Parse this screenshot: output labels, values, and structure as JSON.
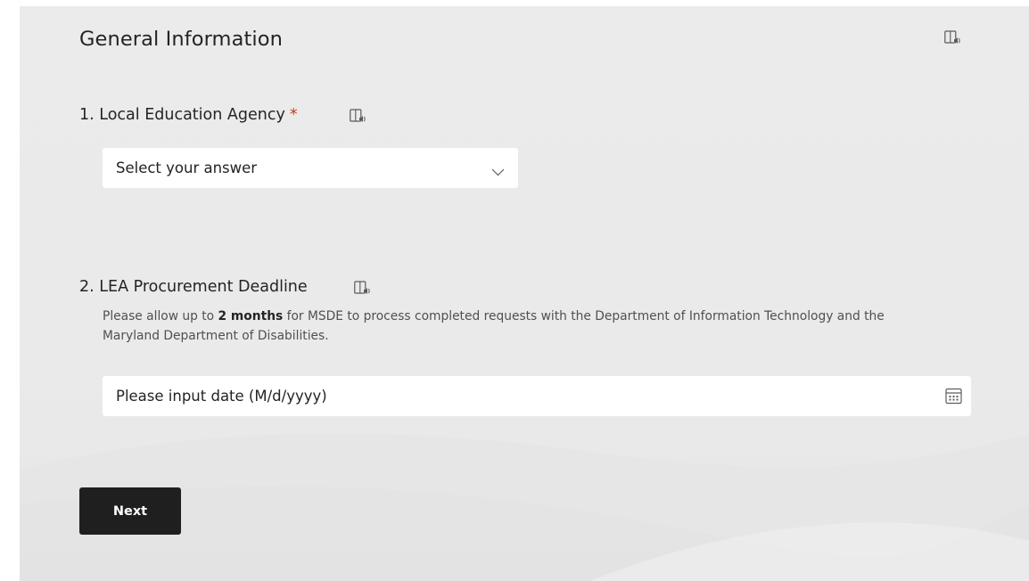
{
  "section": {
    "title": "General Information",
    "reader_icon": "immersive-reader-icon"
  },
  "questions": [
    {
      "number": "1.",
      "title": "Local Education Agency",
      "required_marker": "*",
      "input": {
        "type": "select",
        "value": "Select your answer",
        "icon": "chevron-down-icon"
      }
    },
    {
      "number": "2.",
      "title": "LEA Procurement Deadline",
      "description": {
        "before": "Please allow up to ",
        "bold": "2 months",
        "after": " for MSDE to process completed requests with the Department of Information Technology and the Maryland Department of Disabilities."
      },
      "input": {
        "type": "date",
        "placeholder": "Please input date (M/d/yyyy)",
        "icon": "calendar-icon"
      }
    }
  ],
  "actions": {
    "next_label": "Next"
  },
  "colors": {
    "background": "#ebebeb",
    "required": "#c43e1c",
    "button": "#1f1f1f",
    "input": "#ffffff"
  }
}
